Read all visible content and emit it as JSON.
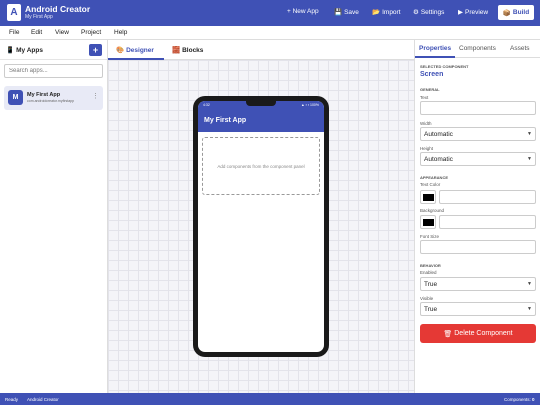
{
  "header": {
    "logo_letter": "A",
    "title": "Android Creator",
    "subtitle": "My First App",
    "buttons": {
      "new_app": "+ New App",
      "save": "Save",
      "import": "Import",
      "settings": "Settings",
      "preview": "Preview",
      "build": "Build"
    },
    "icons": {
      "save": "floppy-disk-icon",
      "import": "folder-icon",
      "settings": "gear-icon",
      "preview": "play-icon",
      "build": "package-icon"
    }
  },
  "menu": {
    "items": [
      "File",
      "Edit",
      "View",
      "Project",
      "Help"
    ]
  },
  "left_panel": {
    "title": "My Apps",
    "title_icon": "phone-icon",
    "add_label": "+",
    "search_placeholder": "Search apps...",
    "apps": [
      {
        "avatar": "M",
        "name": "My First App",
        "package": "com.androidcreator.myfirstapp"
      }
    ]
  },
  "designer": {
    "tabs": [
      {
        "label": "Designer",
        "icon": "palette-icon",
        "active": true
      },
      {
        "label": "Blocks",
        "icon": "bricks-icon",
        "active": false
      }
    ],
    "phone": {
      "time": "4:32",
      "status_icons": "▲ ▪ ▪ 100%",
      "app_bar_title": "My First App",
      "drop_hint": "Add components from the component panel"
    }
  },
  "properties": {
    "tabs": [
      "Properties",
      "Components",
      "Assets"
    ],
    "active_tab": "Properties",
    "selected_label": "SELECTED COMPONENT",
    "selected_component": "Screen",
    "general": {
      "title": "GENERAL",
      "text_label": "Text",
      "text_value": "",
      "width_label": "Width",
      "width_value": "Automatic",
      "height_label": "Height",
      "height_value": "Automatic"
    },
    "appearance": {
      "title": "APPEARANCE",
      "text_color_label": "Text Color",
      "text_color_value": "",
      "text_color": "#000000",
      "background_label": "Background",
      "background_value": "",
      "background_color": "#000000",
      "font_size_label": "Font Size",
      "font_size_value": ""
    },
    "behavior": {
      "title": "BEHAVIOR",
      "enabled_label": "Enabled",
      "enabled_value": "True",
      "visible_label": "Visible",
      "visible_value": "True"
    },
    "delete_label": "Delete Component",
    "delete_icon": "trash-icon"
  },
  "footer": {
    "status": "Ready",
    "app": "Android Creator",
    "components_label": "Components:",
    "components_count": "0"
  },
  "colors": {
    "primary": "#3f51b5",
    "danger": "#e53935"
  }
}
